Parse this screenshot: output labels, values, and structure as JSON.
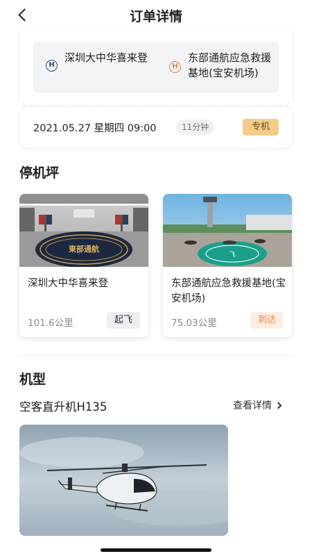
{
  "header": {
    "title": "订单详情"
  },
  "order": {
    "from": "深圳大中华喜来登",
    "to": "东部通航应急救援基地(宝安机场)",
    "from_icon": "H",
    "to_icon": "H",
    "datetime": "2021.05.27 星期四 09:00",
    "duration": "11分钟",
    "type_badge": "专机"
  },
  "pads_section": {
    "title": "停机坪",
    "pads": [
      {
        "name": "深圳大中华喜来登",
        "distance": "101.6公里",
        "tag": "起飞",
        "logo_text": "東部通航"
      },
      {
        "name": "东部通航应急救援基地(宝安机场)",
        "distance": "75.03公里",
        "tag": "到达",
        "pad_text": "飞"
      }
    ]
  },
  "model_section": {
    "title": "机型",
    "model_name": "空客直升机H135",
    "detail_link": "查看详情"
  },
  "colors": {
    "accent_gold": "#f1cd88",
    "accent_orange": "#e8843b",
    "navy": "#2d4e6b"
  }
}
